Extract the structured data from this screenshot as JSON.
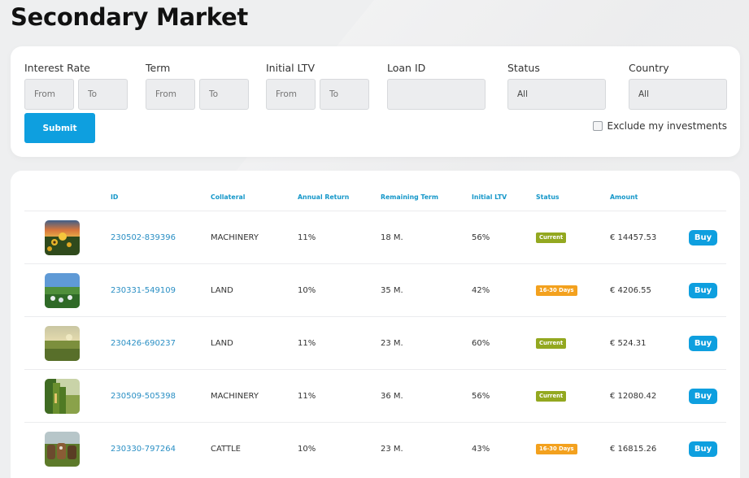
{
  "page": {
    "title": "Secondary Market"
  },
  "filters": {
    "interest_rate": {
      "label": "Interest Rate",
      "from": "From",
      "to": "To"
    },
    "term": {
      "label": "Term",
      "from": "From",
      "to": "To"
    },
    "initial_ltv": {
      "label": "Initial LTV",
      "from": "From",
      "to": "To"
    },
    "loan_id": {
      "label": "Loan ID",
      "value": ""
    },
    "status": {
      "label": "Status",
      "value": "All"
    },
    "country": {
      "label": "Country",
      "value": "All"
    },
    "submit_label": "Submit",
    "exclude_label": "Exclude my investments"
  },
  "table": {
    "headers": {
      "id": "ID",
      "collateral": "Collateral",
      "annual_return": "Annual Return",
      "remaining_term": "Remaining Term",
      "initial_ltv": "Initial LTV",
      "status": "Status",
      "amount": "Amount"
    },
    "rows": [
      {
        "thumb": "sunflower-field",
        "id": "230502-839396",
        "collateral": "MACHINERY",
        "annual_return": "11%",
        "remaining_term": "18 M.",
        "initial_ltv": "56%",
        "status": "Current",
        "status_color": "#93a820",
        "amount": "€ 14457.53",
        "buy": "Buy"
      },
      {
        "thumb": "green-field-sky",
        "id": "230331-549109",
        "collateral": "LAND",
        "annual_return": "10%",
        "remaining_term": "35 M.",
        "initial_ltv": "42%",
        "status": "16-30 Days",
        "status_color": "#f3a11e",
        "amount": "€ 4206.55",
        "buy": "Buy"
      },
      {
        "thumb": "misty-field",
        "id": "230426-690237",
        "collateral": "LAND",
        "annual_return": "11%",
        "remaining_term": "23 M.",
        "initial_ltv": "60%",
        "status": "Current",
        "status_color": "#93a820",
        "amount": "€ 524.31",
        "buy": "Buy"
      },
      {
        "thumb": "corn-field",
        "id": "230509-505398",
        "collateral": "MACHINERY",
        "annual_return": "11%",
        "remaining_term": "36 M.",
        "initial_ltv": "56%",
        "status": "Current",
        "status_color": "#93a820",
        "amount": "€ 12080.42",
        "buy": "Buy"
      },
      {
        "thumb": "cattle",
        "id": "230330-797264",
        "collateral": "CATTLE",
        "annual_return": "10%",
        "remaining_term": "23 M.",
        "initial_ltv": "43%",
        "status": "16-30 Days",
        "status_color": "#f3a11e",
        "amount": "€ 16815.26",
        "buy": "Buy"
      }
    ]
  },
  "colors": {
    "accent": "#0e9fdf",
    "header_text": "#1597c9",
    "current": "#93a820",
    "late": "#f3a11e"
  }
}
